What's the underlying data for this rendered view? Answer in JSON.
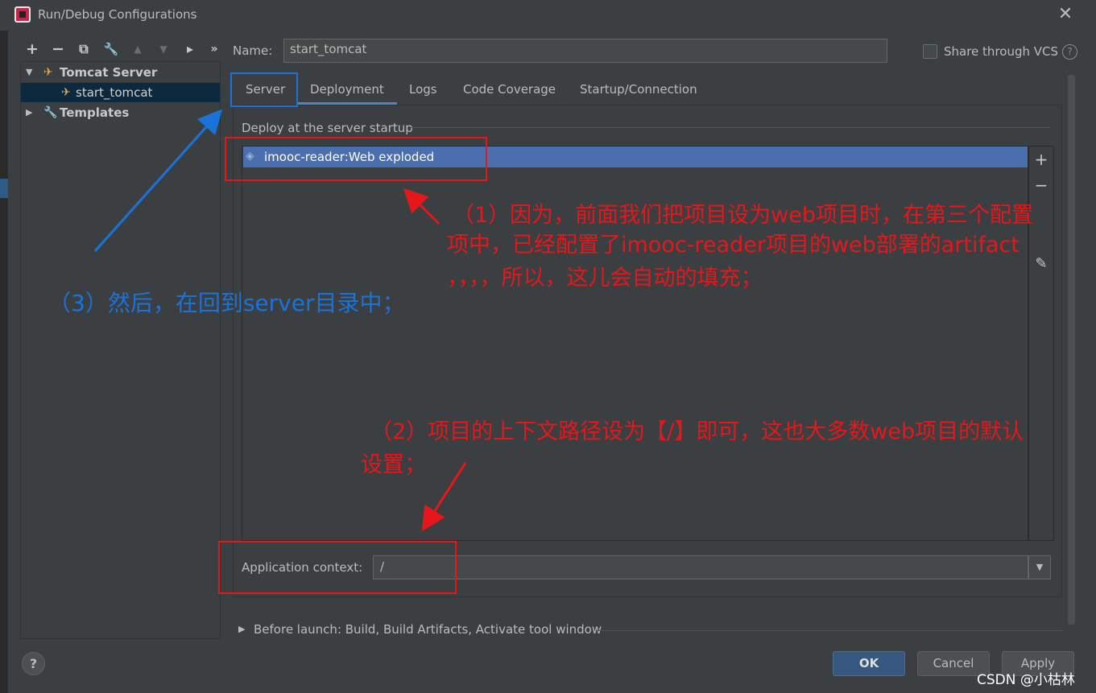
{
  "window": {
    "title": "Run/Debug Configurations",
    "close_glyph": "✕"
  },
  "toolbar": {
    "add": "+",
    "remove": "−",
    "copy": "⧉",
    "edit": "🔧",
    "up": "▲",
    "down": "▼",
    "folder": "▸",
    "more": "»"
  },
  "tree": {
    "group": "Tomcat Server",
    "child": "start_tomcat",
    "templates": "Templates"
  },
  "form": {
    "name_label": "Name:",
    "name_value": "start_tomcat",
    "vcs_label": "Share through VCS",
    "help": "?"
  },
  "tabs": [
    "Server",
    "Deployment",
    "Logs",
    "Code Coverage",
    "Startup/Connection"
  ],
  "deploy": {
    "section_label": "Deploy at the server startup",
    "artifact": "imooc-reader:Web exploded",
    "add": "+",
    "remove": "−",
    "edit": "✎"
  },
  "context": {
    "label": "Application context:",
    "value": "/",
    "dropdown": "▼"
  },
  "before_launch": {
    "label": "Before launch: Build, Build Artifacts, Activate tool window"
  },
  "buttons": {
    "help": "?",
    "ok": "OK",
    "cancel": "Cancel",
    "apply": "Apply"
  },
  "annotations": {
    "note1_line1": "（1）因为，前面我们把项目设为web项目时，在第三个配置",
    "note1_line2": "项中，已经配置了imooc-reader项目的web部署的artifact",
    "note1_line3": "，，，，所以，这儿会自动的填充；",
    "note2_line1": "（2）项目的上下文路径设为【/】即可，这也大多数web项目的默认",
    "note2_line2": "设置；",
    "note3": "（3）然后，在回到server目录中；",
    "red": "#e5171b",
    "blue": "#1a73d9"
  },
  "watermark": "CSDN @小枯林",
  "icons": {
    "app": "intellij-logo-icon",
    "tomcat": "tomcat-icon",
    "wrench": "wrench-icon",
    "artifact": "web-artifact-icon"
  }
}
